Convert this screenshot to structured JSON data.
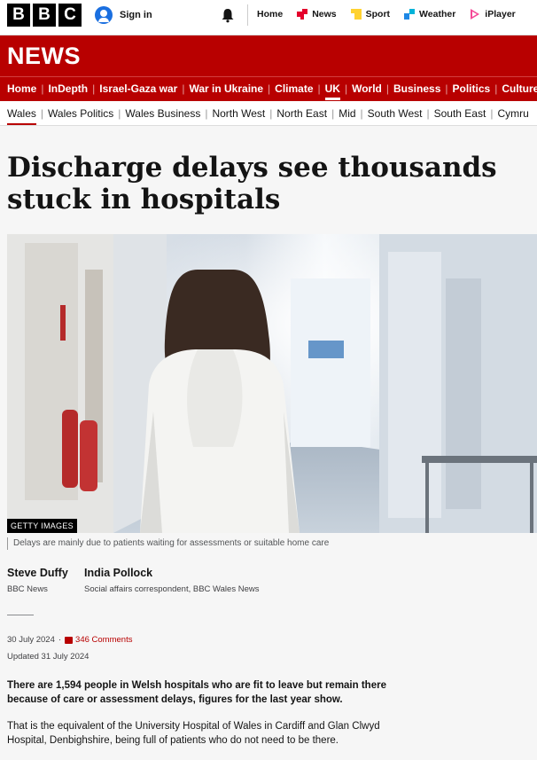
{
  "header": {
    "logo_letters": [
      "B",
      "B",
      "C"
    ],
    "signin_label": "Sign in",
    "nav": [
      {
        "label": "Home",
        "icon": "home-icon"
      },
      {
        "label": "News",
        "icon": "news-icon",
        "color": "#e4002b"
      },
      {
        "label": "Sport",
        "icon": "sport-icon",
        "color": "#ffd230"
      },
      {
        "label": "Weather",
        "icon": "weather-icon",
        "color": "#1e88e5"
      },
      {
        "label": "iPlayer",
        "icon": "iplayer-icon",
        "color": "#f54997"
      }
    ]
  },
  "section": {
    "title": "NEWS",
    "brand_color": "#b80000",
    "main_nav": [
      "Home",
      "InDepth",
      "Israel-Gaza war",
      "War in Ukraine",
      "Climate",
      "UK",
      "World",
      "Business",
      "Politics",
      "Culture"
    ],
    "main_nav_active": "UK",
    "sub_nav": [
      "Wales",
      "Wales Politics",
      "Wales Business",
      "North West",
      "North East",
      "Mid",
      "South West",
      "South East",
      "Cymru"
    ],
    "sub_nav_active": "Wales"
  },
  "article": {
    "headline": "Discharge delays see thousands stuck in hospitals",
    "image_credit": "GETTY IMAGES",
    "image_caption": "Delays are mainly due to patients waiting for assessments or suitable home care",
    "authors": [
      {
        "name": "Steve Duffy",
        "role": "BBC News"
      },
      {
        "name": "India Pollock",
        "role": "Social affairs correspondent, BBC Wales News"
      }
    ],
    "date": "30 July 2024",
    "comments": "346 Comments",
    "updated": "Updated 31 July 2024",
    "lead": "There are 1,594 people in Welsh hospitals who are fit to leave but remain there because of care or assessment delays, figures for the last year show.",
    "paragraph_1": "That is the equivalent of the University Hospital of Wales in Cardiff and Glan Clwyd Hospital, Denbighshire, being full of patients who do not need to be there."
  }
}
